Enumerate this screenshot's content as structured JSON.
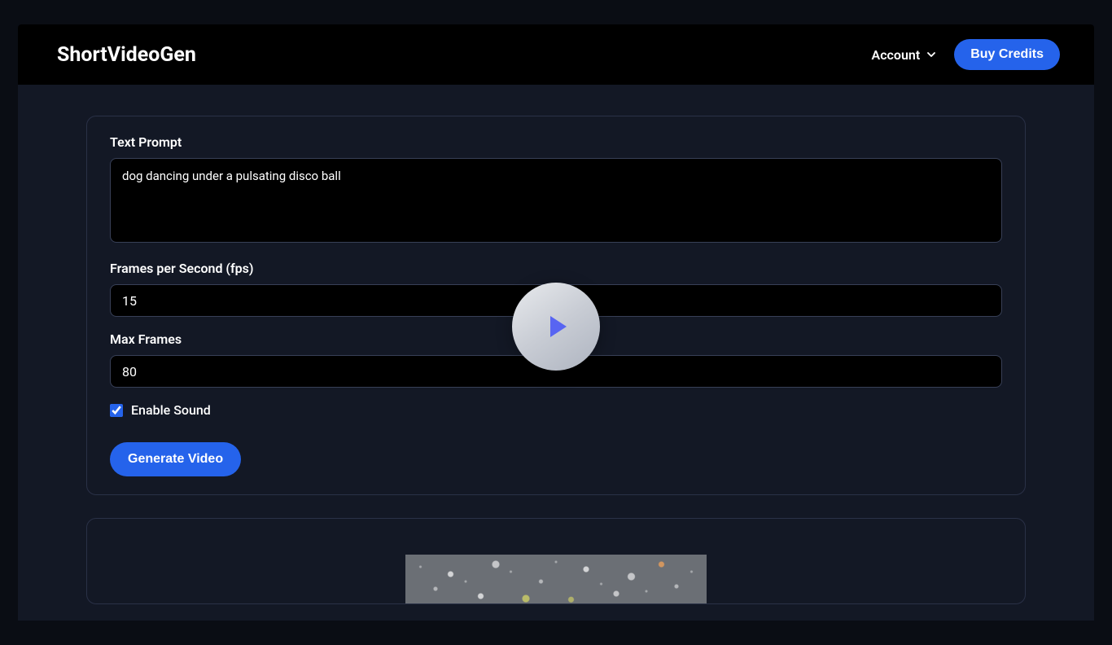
{
  "header": {
    "logo": "ShortVideoGen",
    "account_label": "Account",
    "buy_credits_label": "Buy Credits"
  },
  "form": {
    "text_prompt_label": "Text Prompt",
    "text_prompt_value": "dog dancing under a pulsating disco ball",
    "fps_label": "Frames per Second (fps)",
    "fps_value": "15",
    "max_frames_label": "Max Frames",
    "max_frames_value": "80",
    "enable_sound_label": "Enable Sound",
    "enable_sound_checked": true,
    "generate_button_label": "Generate Video"
  }
}
